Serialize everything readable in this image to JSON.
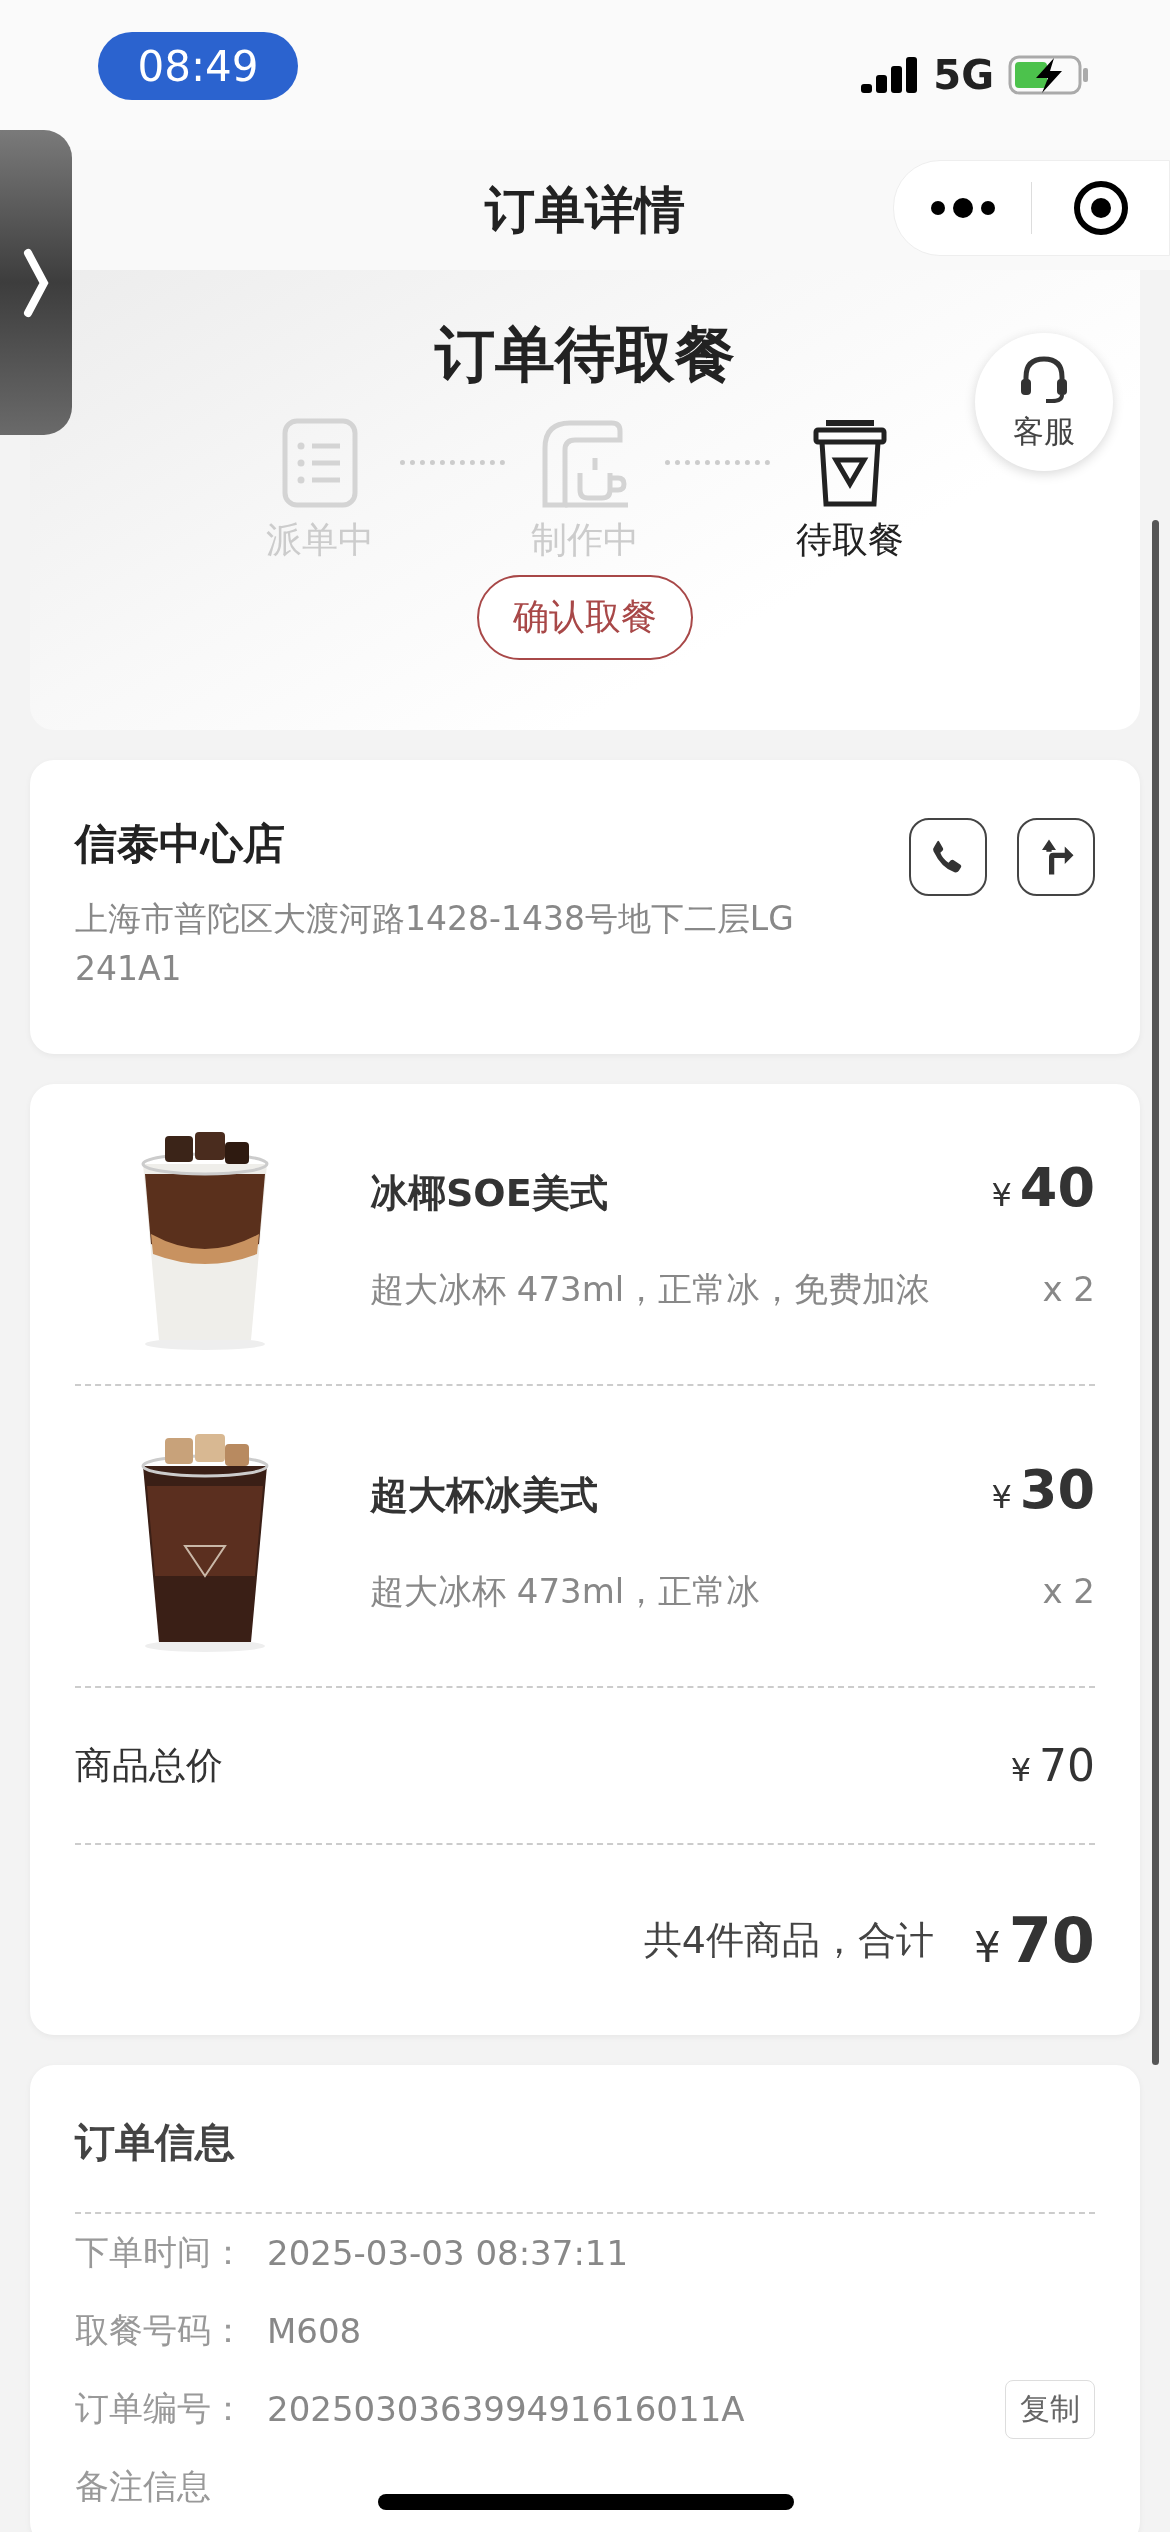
{
  "status_bar": {
    "time": "08:49",
    "network": "5G"
  },
  "nav": {
    "title": "订单详情"
  },
  "order_status": {
    "title": "订单待取餐",
    "steps": [
      {
        "kind": "dispatch",
        "label": "派单中",
        "selected": false
      },
      {
        "kind": "making",
        "label": "制作中",
        "selected": false
      },
      {
        "kind": "pickup",
        "label": "待取餐",
        "selected": true
      }
    ],
    "confirm_button": "确认取餐"
  },
  "service_button": {
    "label": "客服"
  },
  "store": {
    "name": "信泰中心店",
    "address": "上海市普陀区大渡河路1428-1438号地下二层LG241A1"
  },
  "items": [
    {
      "name": "冰椰SOE美式",
      "options": "超大冰杯 473ml，正常冰，免费加浓",
      "currency": "¥",
      "price": "40",
      "quantity": "x 2"
    },
    {
      "name": "超大杯冰美式",
      "options": "超大冰杯 473ml，正常冰",
      "currency": "¥",
      "price": "30",
      "quantity": "x 2"
    }
  ],
  "subtotal": {
    "label": "商品总价",
    "currency": "¥",
    "amount": "70"
  },
  "total": {
    "label": "共4件商品，合计",
    "currency": "¥",
    "amount": "70"
  },
  "order_info": {
    "title": "订单信息",
    "rows": [
      {
        "label": "下单时间：",
        "value": "2025-03-03 08:37:11"
      },
      {
        "label": "取餐号码：",
        "value": "M608"
      },
      {
        "label": "订单编号：",
        "value": "202503036399491616011A",
        "action": "复制"
      },
      {
        "label": "备注信息"
      }
    ]
  }
}
